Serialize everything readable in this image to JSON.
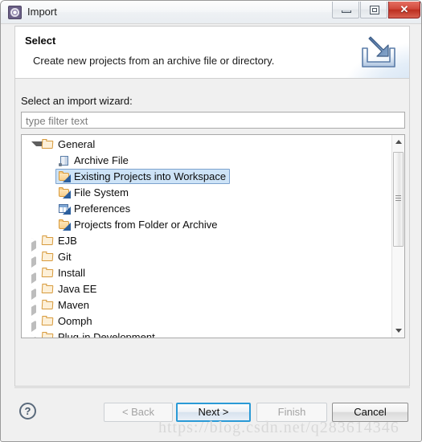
{
  "window": {
    "title": "Import",
    "app_icon": "eclipse-import-icon",
    "controls": {
      "minimize": "minimize-icon",
      "maximize": "maximize-icon",
      "close": "✕"
    }
  },
  "header": {
    "title": "Select",
    "description": "Create new projects from an archive file or directory.",
    "banner_icon": "import-arrow-into-tray-icon"
  },
  "body": {
    "wizard_label": "Select an import wizard:",
    "filter": {
      "value": "",
      "placeholder": "type filter text"
    },
    "tree": [
      {
        "label": "General",
        "depth": 0,
        "icon": "folder-open-icon",
        "twisty": "expanded",
        "selected": false,
        "clipped": false
      },
      {
        "label": "Archive File",
        "depth": 1,
        "icon": "archive-file-icon",
        "twisty": "none",
        "selected": false,
        "clipped": false
      },
      {
        "label": "Existing Projects into Workspace",
        "depth": 1,
        "icon": "folder-import-icon",
        "twisty": "none",
        "selected": true,
        "clipped": false
      },
      {
        "label": "File System",
        "depth": 1,
        "icon": "folder-import-icon",
        "twisty": "none",
        "selected": false,
        "clipped": false
      },
      {
        "label": "Preferences",
        "depth": 1,
        "icon": "preferences-icon",
        "twisty": "none",
        "selected": false,
        "clipped": false
      },
      {
        "label": "Projects from Folder or Archive",
        "depth": 1,
        "icon": "folder-import-icon",
        "twisty": "none",
        "selected": false,
        "clipped": false
      },
      {
        "label": "EJB",
        "depth": 0,
        "icon": "folder-open-icon",
        "twisty": "collapsed",
        "selected": false,
        "clipped": false
      },
      {
        "label": "Git",
        "depth": 0,
        "icon": "folder-open-icon",
        "twisty": "collapsed",
        "selected": false,
        "clipped": false
      },
      {
        "label": "Install",
        "depth": 0,
        "icon": "folder-open-icon",
        "twisty": "collapsed",
        "selected": false,
        "clipped": false
      },
      {
        "label": "Java EE",
        "depth": 0,
        "icon": "folder-open-icon",
        "twisty": "collapsed",
        "selected": false,
        "clipped": false
      },
      {
        "label": "Maven",
        "depth": 0,
        "icon": "folder-open-icon",
        "twisty": "collapsed",
        "selected": false,
        "clipped": false
      },
      {
        "label": "Oomph",
        "depth": 0,
        "icon": "folder-open-icon",
        "twisty": "collapsed",
        "selected": false,
        "clipped": false
      },
      {
        "label": "Plug-in Development",
        "depth": 0,
        "icon": "folder-open-icon",
        "twisty": "collapsed",
        "selected": false,
        "clipped": true
      }
    ],
    "scrollbar": {
      "up_arrow": "scroll-up-icon",
      "down_arrow": "scroll-down-icon",
      "thumb_top_pct": 8,
      "thumb_height_pct": 47
    }
  },
  "footer": {
    "help": "?",
    "back": {
      "label": "< Back",
      "enabled": false,
      "default": false
    },
    "next": {
      "label": "Next >",
      "enabled": true,
      "default": true
    },
    "finish": {
      "label": "Finish",
      "enabled": false,
      "default": false
    },
    "cancel": {
      "label": "Cancel",
      "enabled": true,
      "default": false
    }
  },
  "watermark": "https://blog.csdn.net/q283614346",
  "colors": {
    "selection_fill": "#cde3f7",
    "selection_border": "#7da2ce",
    "default_button_border": "#2a9ad6",
    "close_button": "#c33a2a",
    "folder_orange": "#d79a3c",
    "title_bar": "#f2f5f8"
  }
}
